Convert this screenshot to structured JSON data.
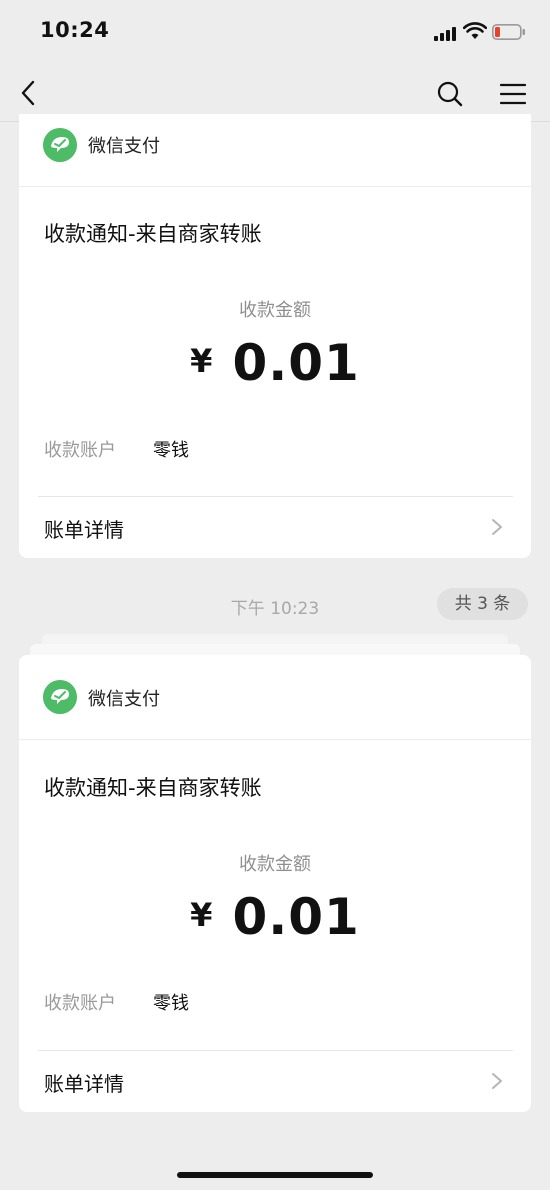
{
  "status_bar": {
    "time": "10:24",
    "signal_icon": "cellular-signal-icon",
    "wifi_icon": "wifi-icon",
    "battery_icon": "battery-low-icon",
    "battery_color": "#e5432e"
  },
  "nav": {
    "back_icon": "chevron-left-icon",
    "search_icon": "search-icon",
    "menu_icon": "menu-icon"
  },
  "colors": {
    "accent": "#4ebc66",
    "background": "#ededed",
    "card": "#ffffff"
  },
  "messages": [
    {
      "app_name": "微信支付",
      "title": "收款通知-来自商家转账",
      "amount_label": "收款金额",
      "currency": "¥",
      "amount": "0.01",
      "account_label": "收款账户",
      "account_value": "零钱",
      "detail_label": "账单详情"
    },
    {
      "app_name": "微信支付",
      "title": "收款通知-来自商家转账",
      "amount_label": "收款金额",
      "currency": "¥",
      "amount": "0.01",
      "account_label": "收款账户",
      "account_value": "零钱",
      "detail_label": "账单详情"
    }
  ],
  "timestamp": "下午 10:23",
  "count_badge": "共 3 条"
}
